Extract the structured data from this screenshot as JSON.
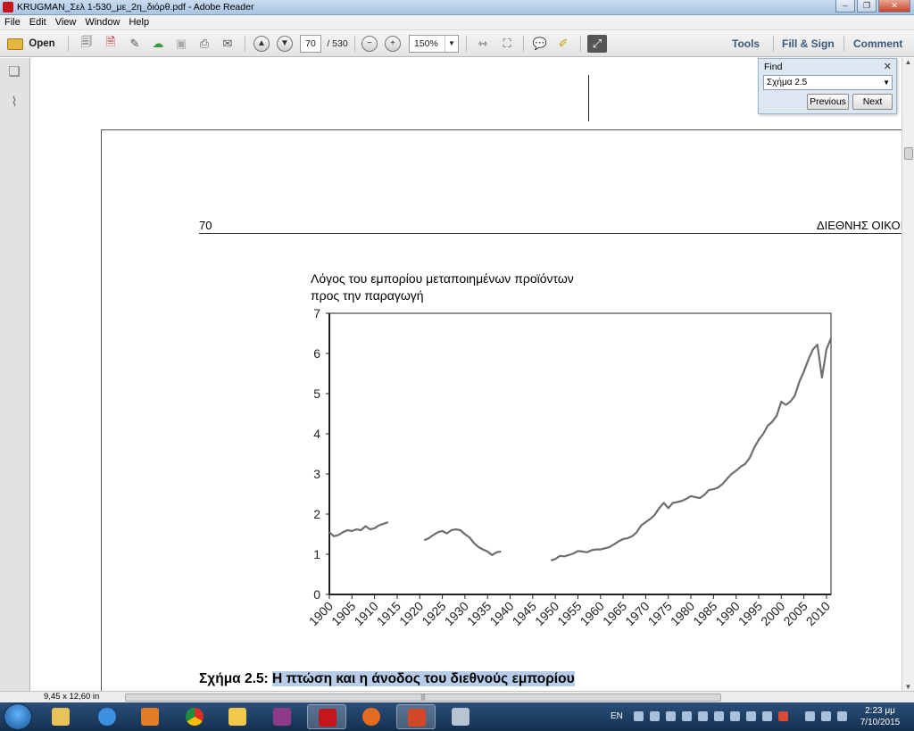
{
  "window": {
    "title": "KRUGMAN_Σελ 1-530_με_2η_διόρθ.pdf - Adobe Reader"
  },
  "menu": [
    "File",
    "Edit",
    "View",
    "Window",
    "Help"
  ],
  "toolbar": {
    "open_label": "Open",
    "current_page": "70",
    "total_pages": "/ 530",
    "zoom": "150%",
    "tools_label": "Tools",
    "fill_sign_label": "Fill & Sign",
    "comment_label": "Comment"
  },
  "find": {
    "title": "Find",
    "query": "Σχήμα 2.5",
    "previous_label": "Previous",
    "next_label": "Next"
  },
  "document": {
    "page_number": "70",
    "running_head": "ΔΙΕΘΝΗΣ ΟΙΚΟΙ",
    "figure_caption_prefix": "Σχήμα 2.5:",
    "figure_caption_highlight": "Η πτώση και η άνοδος του διεθνούς εμπορίου"
  },
  "chart_data": {
    "type": "line",
    "title": "",
    "ylabel": "Λόγος του εμπορίου μεταποιημένων προϊόντων προς την παραγωγή",
    "xlabel": "",
    "xlim": [
      1900,
      2011
    ],
    "ylim": [
      0,
      7
    ],
    "xticks": [
      1900,
      1905,
      1910,
      1915,
      1920,
      1925,
      1930,
      1935,
      1940,
      1945,
      1950,
      1955,
      1960,
      1965,
      1970,
      1975,
      1980,
      1985,
      1990,
      1995,
      2000,
      2005,
      2010
    ],
    "yticks": [
      0,
      1,
      2,
      3,
      4,
      5,
      6,
      7
    ],
    "series": [
      {
        "segments": [
          [
            [
              1900,
              1.55
            ],
            [
              1901,
              1.45
            ],
            [
              1902,
              1.48
            ],
            [
              1903,
              1.55
            ],
            [
              1904,
              1.6
            ],
            [
              1905,
              1.58
            ],
            [
              1906,
              1.62
            ],
            [
              1907,
              1.6
            ],
            [
              1908,
              1.7
            ],
            [
              1909,
              1.62
            ],
            [
              1910,
              1.65
            ],
            [
              1911,
              1.72
            ],
            [
              1912,
              1.76
            ],
            [
              1913,
              1.8
            ]
          ],
          [
            [
              1921,
              1.35
            ],
            [
              1922,
              1.4
            ],
            [
              1923,
              1.48
            ],
            [
              1924,
              1.55
            ],
            [
              1925,
              1.58
            ],
            [
              1926,
              1.52
            ],
            [
              1927,
              1.6
            ],
            [
              1928,
              1.62
            ],
            [
              1929,
              1.6
            ],
            [
              1930,
              1.5
            ],
            [
              1931,
              1.42
            ],
            [
              1932,
              1.28
            ],
            [
              1933,
              1.18
            ],
            [
              1934,
              1.12
            ],
            [
              1935,
              1.07
            ],
            [
              1936,
              0.98
            ],
            [
              1937,
              1.05
            ],
            [
              1938,
              1.07
            ]
          ],
          [
            [
              1949,
              0.85
            ],
            [
              1950,
              0.88
            ],
            [
              1951,
              0.96
            ],
            [
              1952,
              0.95
            ],
            [
              1953,
              0.98
            ],
            [
              1954,
              1.02
            ],
            [
              1955,
              1.08
            ],
            [
              1956,
              1.07
            ],
            [
              1957,
              1.05
            ],
            [
              1958,
              1.1
            ],
            [
              1959,
              1.12
            ],
            [
              1960,
              1.12
            ],
            [
              1961,
              1.15
            ],
            [
              1962,
              1.18
            ],
            [
              1963,
              1.25
            ],
            [
              1964,
              1.32
            ],
            [
              1965,
              1.38
            ],
            [
              1966,
              1.4
            ],
            [
              1967,
              1.45
            ],
            [
              1968,
              1.55
            ],
            [
              1969,
              1.72
            ],
            [
              1970,
              1.8
            ],
            [
              1971,
              1.88
            ],
            [
              1972,
              1.98
            ],
            [
              1973,
              2.15
            ],
            [
              1974,
              2.28
            ],
            [
              1975,
              2.15
            ],
            [
              1976,
              2.28
            ],
            [
              1977,
              2.3
            ],
            [
              1978,
              2.33
            ],
            [
              1979,
              2.38
            ],
            [
              1980,
              2.45
            ],
            [
              1981,
              2.42
            ],
            [
              1982,
              2.4
            ],
            [
              1983,
              2.48
            ],
            [
              1984,
              2.6
            ],
            [
              1985,
              2.62
            ],
            [
              1986,
              2.66
            ],
            [
              1987,
              2.75
            ],
            [
              1988,
              2.88
            ],
            [
              1989,
              3.0
            ],
            [
              1990,
              3.08
            ],
            [
              1991,
              3.18
            ],
            [
              1992,
              3.25
            ],
            [
              1993,
              3.4
            ],
            [
              1994,
              3.65
            ],
            [
              1995,
              3.85
            ],
            [
              1996,
              4.0
            ],
            [
              1997,
              4.2
            ],
            [
              1998,
              4.3
            ],
            [
              1999,
              4.45
            ],
            [
              2000,
              4.8
            ],
            [
              2001,
              4.72
            ],
            [
              2002,
              4.8
            ],
            [
              2003,
              4.95
            ],
            [
              2004,
              5.3
            ],
            [
              2005,
              5.55
            ],
            [
              2006,
              5.85
            ],
            [
              2007,
              6.1
            ],
            [
              2008,
              6.22
            ],
            [
              2009,
              5.4
            ],
            [
              2010,
              6.1
            ],
            [
              2011,
              6.38
            ]
          ]
        ]
      }
    ],
    "grid": false,
    "legend": "none"
  },
  "status": {
    "page_size": "9,45 x 12,60 in"
  },
  "taskbar": {
    "lang": "EN",
    "time": "2:23 μμ",
    "date": "7/10/2015"
  }
}
